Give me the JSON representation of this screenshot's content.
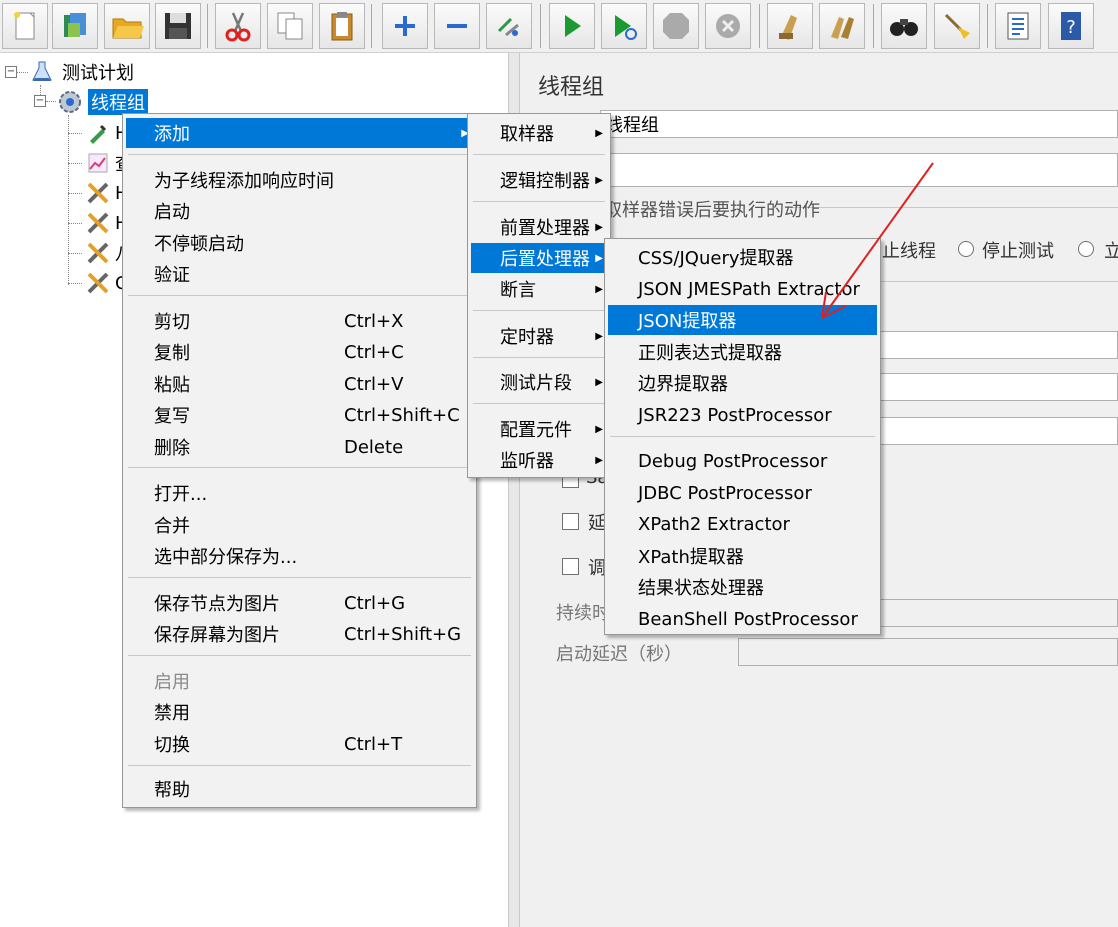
{
  "toolbar": {
    "buttons": [
      "new-icon",
      "templates-icon",
      "open-icon",
      "save-icon",
      "cut-icon",
      "copy-icon",
      "paste-icon",
      "expand-icon",
      "collapse-icon",
      "toggle-icon",
      "start-icon",
      "start-no-pause-icon",
      "stop-icon",
      "shutdown-icon",
      "clear-icon",
      "clear-all-icon",
      "search-icon",
      "reset-search-icon",
      "function-helper-icon",
      "help-icon"
    ]
  },
  "tree": {
    "test_plan": "测试计划",
    "thread_group": "线程组",
    "children_partial": [
      "H",
      "查",
      "H",
      "H",
      "八",
      "C"
    ]
  },
  "panel": {
    "title": "线程组",
    "name_value": "线程组",
    "error_action_label": "取样器错误后要执行的动作",
    "radio_stop_thread": "止线程",
    "radio_stop_test": "停止测试",
    "radio_more": "立",
    "check_same": "Sa",
    "check_delay": "延",
    "check_scheduler": "调",
    "duration_label": "持续时",
    "startup_delay_label": "启动延迟（秒）"
  },
  "context_menu": {
    "items": {
      "add": "添加",
      "add_think_times": "为子线程添加响应时间",
      "start": "启动",
      "start_no_pause": "不停顿启动",
      "validate": "验证",
      "cut": "剪切",
      "copy": "复制",
      "paste": "粘贴",
      "duplicate": "复写",
      "delete": "删除",
      "open": "打开...",
      "merge": "合并",
      "save_selection": "选中部分保存为...",
      "save_node_image": "保存节点为图片",
      "save_screen_image": "保存屏幕为图片",
      "enable": "启用",
      "disable": "禁用",
      "toggle": "切换",
      "help": "帮助"
    },
    "shortcuts": {
      "cut": "Ctrl+X",
      "copy": "Ctrl+C",
      "paste": "Ctrl+V",
      "duplicate": "Ctrl+Shift+C",
      "delete": "Delete",
      "save_node_image": "Ctrl+G",
      "save_screen_image": "Ctrl+Shift+G",
      "toggle": "Ctrl+T"
    }
  },
  "add_submenu": {
    "sampler": "取样器",
    "logic_controller": "逻辑控制器",
    "pre_processors": "前置处理器",
    "post_processors": "后置处理器",
    "assertions": "断言",
    "timer": "定时器",
    "test_fragment": "测试片段",
    "config_element": "配置元件",
    "listener": "监听器"
  },
  "post_processor_submenu": {
    "css_jquery": "CSS/JQuery提取器",
    "json_jmespath": "JSON JMESPath Extractor",
    "json_extractor": "JSON提取器",
    "regex_extractor": "正则表达式提取器",
    "boundary_extractor": "边界提取器",
    "jsr223": "JSR223 PostProcessor",
    "debug": "Debug PostProcessor",
    "jdbc": "JDBC PostProcessor",
    "xpath2": "XPath2 Extractor",
    "xpath": "XPath提取器",
    "result_status": "结果状态处理器",
    "beanshell": "BeanShell PostProcessor"
  },
  "colors": {
    "highlight": "#0078d7",
    "annotation_arrow": "#e02020"
  }
}
